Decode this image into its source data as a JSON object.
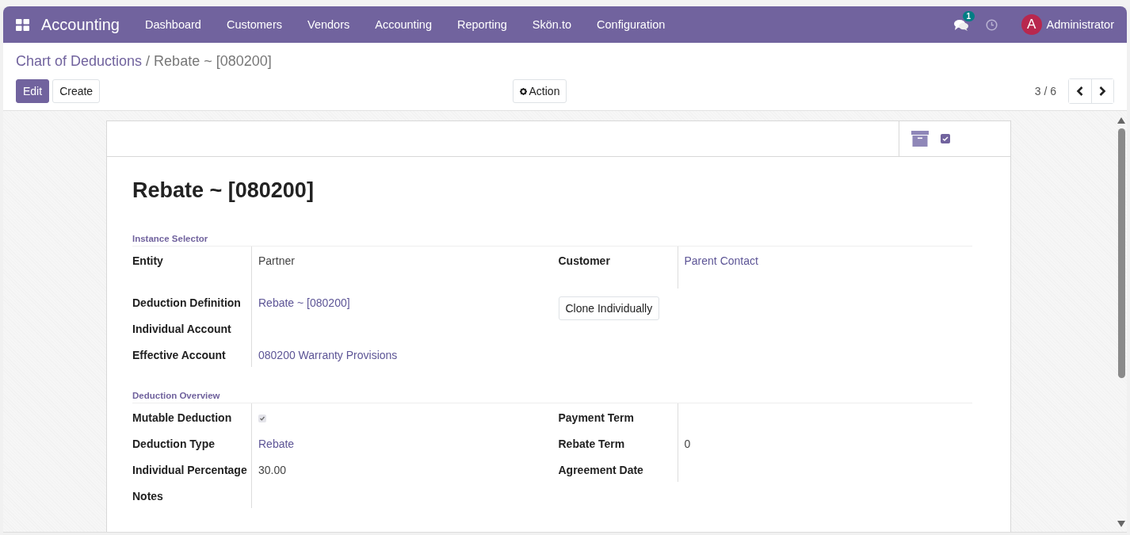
{
  "navbar": {
    "app_name": "Accounting",
    "menu": [
      {
        "label": "Dashboard"
      },
      {
        "label": "Customers"
      },
      {
        "label": "Vendors"
      },
      {
        "label": "Accounting"
      },
      {
        "label": "Reporting"
      },
      {
        "label": "Skön.to"
      },
      {
        "label": "Configuration"
      }
    ],
    "messages_badge": "1",
    "avatar_letter": "A",
    "user": "Administrator"
  },
  "breadcrumb": {
    "parent": "Chart of Deductions",
    "separator": "/",
    "current": "Rebate ~ [080200]"
  },
  "buttons": {
    "edit": "Edit",
    "create": "Create",
    "action": "Action"
  },
  "pager": "3 / 6",
  "record": {
    "title": "Rebate ~ [080200]",
    "sections": [
      {
        "title": "Instance Selector",
        "left": [
          {
            "label": "Entity",
            "kind": "text",
            "value": "Partner"
          },
          {
            "label": "Deduction Definition",
            "kind": "link",
            "value": "Rebate ~ [080200]"
          },
          {
            "label": "Individual Account",
            "kind": "text"
          },
          {
            "label": "Effective Account",
            "kind": "link",
            "value": "080200 Warranty Provisions"
          }
        ],
        "right": [
          {
            "label": "Customer",
            "kind": "link",
            "value": "Parent Contact"
          },
          {
            "kind": "button",
            "value": "Clone Individually"
          }
        ]
      },
      {
        "title": "Deduction Overview",
        "left": [
          {
            "label": "Mutable Deduction",
            "kind": "checkbox",
            "checked": true
          },
          {
            "label": "Deduction Type",
            "kind": "link",
            "value": "Rebate"
          },
          {
            "label": "Individual Percentage",
            "kind": "text",
            "value": "30.00"
          },
          {
            "label": "Notes",
            "kind": "text"
          }
        ],
        "right": [
          {
            "label": "Payment Term",
            "kind": "text"
          },
          {
            "label": "Rebate Term",
            "kind": "text",
            "value": "0"
          },
          {
            "label": "Agreement Date",
            "kind": "text"
          }
        ]
      }
    ]
  }
}
